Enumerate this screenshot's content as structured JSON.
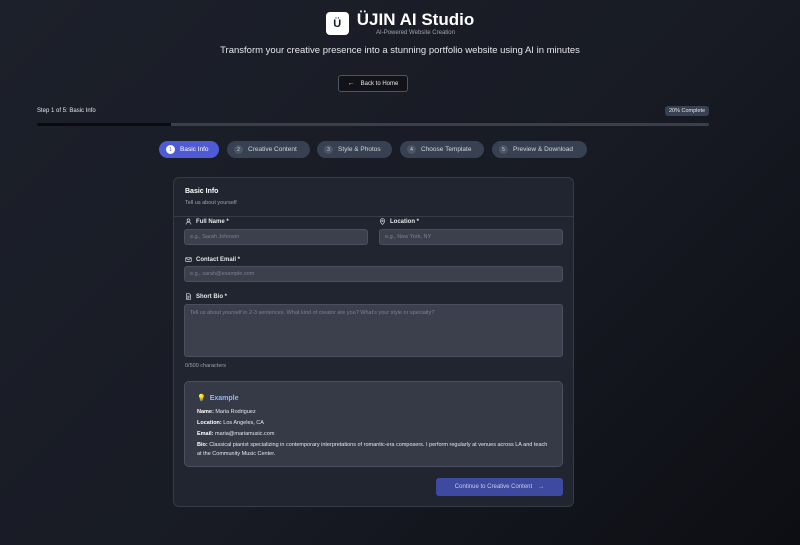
{
  "header": {
    "logo_glyph": "Ü",
    "title": "ÜJIN AI Studio",
    "subtitle": "AI-Powered Website Creation",
    "tagline": "Transform your creative presence into a stunning portfolio website using AI in minutes",
    "back_label": "Back to Home",
    "back_icon": "arrow-left-icon"
  },
  "progress": {
    "step_label": "Step 1 of 5: Basic Info",
    "percent_label": "20% Complete",
    "fill_fraction": 0.2
  },
  "steps": [
    {
      "num": "1",
      "label": "Basic Info",
      "active": true
    },
    {
      "num": "2",
      "label": "Creative Content",
      "active": false
    },
    {
      "num": "3",
      "label": "Style & Photos",
      "active": false
    },
    {
      "num": "4",
      "label": "Choose Template",
      "active": false
    },
    {
      "num": "5",
      "label": "Preview & Download",
      "active": false
    }
  ],
  "form": {
    "title": "Basic Info",
    "subtitle": "Tell us about yourself",
    "full_name": {
      "label": "Full Name *",
      "placeholder": "e.g., Sarah Johnson",
      "value": "",
      "icon": "user-icon"
    },
    "location": {
      "label": "Location *",
      "placeholder": "e.g., New York, NY",
      "value": "",
      "icon": "map-pin-icon"
    },
    "email": {
      "label": "Contact Email *",
      "placeholder": "e.g., sarah@example.com",
      "value": "",
      "icon": "mail-icon"
    },
    "bio": {
      "label": "Short Bio *",
      "placeholder": "Tell us about yourself in 2-3 sentences. What kind of creator are you? What's your style or specialty?",
      "value": "",
      "icon": "document-icon"
    },
    "char_count": "0/500 characters"
  },
  "example": {
    "icon": "lightbulb-icon",
    "title": "Example",
    "name_label": "Name:",
    "name_value": "Maria Rodriguez",
    "location_label": "Location:",
    "location_value": "Los Angeles, CA",
    "email_label": "Email:",
    "email_value": "maria@mariamusic.com",
    "bio_label": "Bio:",
    "bio_value": "Classical pianist specializing in contemporary interpretations of romantic-era composers. I perform regularly at venues across LA and teach at the Community Music Center."
  },
  "continue_label": "Continue to Creative Content",
  "colors": {
    "accent": "#4f5bd5",
    "continue_button": "#3e4aa0",
    "example_title": "#93b4f7"
  }
}
